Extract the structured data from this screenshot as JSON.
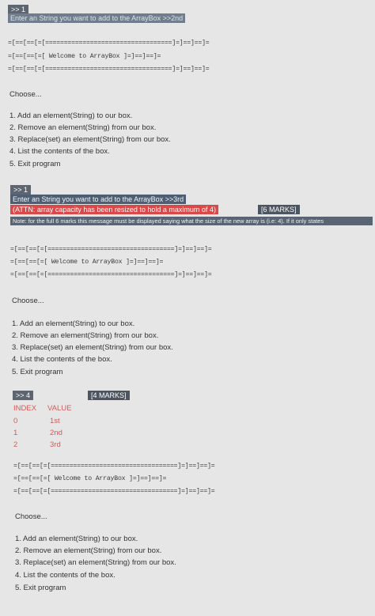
{
  "block1": {
    "tag": ">> 1",
    "prompt": "Enter an String you want to add to the ArrayBox >>2nd",
    "banner": [
      "=[==[==[=[==================================]=]==]==]=",
      "=[==[==[=[     Welcome to ArrayBox       ]=]==]==]=",
      "=[==[==[=[==================================]=]==]==]="
    ],
    "choose": "Choose...",
    "menu": [
      "1. Add an element(String) to our box.",
      "2. Remove an element(String) from our box.",
      "3. Replace(set) an element(String) from our box.",
      "4. List the contents of the box.",
      "5. Exit program"
    ]
  },
  "block2": {
    "tag": ">> 1",
    "prompt": "Enter an String you want to add to the ArrayBox >>3rd",
    "attn": "(ATTN: array capacity has been resized to hold a maximum of 4)",
    "marks": "[6 MARKS]",
    "note": "Note: for the full 6 marks this message must be displayed saying what the size of the new array is (i.e: 4). If it only states",
    "banner": [
      "=[==[==[=[==================================]=]==]==]=",
      "=[==[==[=[     Welcome to ArrayBox       ]=]==]==]=",
      "=[==[==[=[==================================]=]==]==]="
    ],
    "choose": "Choose...",
    "menu": [
      "1. Add an element(String) to our box.",
      "2. Remove an element(String) from our box.",
      "3. Replace(set) an element(String) from our box.",
      "4. List the contents of the box.",
      "5. Exit program"
    ]
  },
  "block3": {
    "tag": ">> 4",
    "marks": "[4 MARKS]",
    "headers": [
      "INDEX",
      "VALUE"
    ],
    "rows": [
      {
        "index": "0",
        "value": "1st"
      },
      {
        "index": "1",
        "value": "2nd"
      },
      {
        "index": "2",
        "value": "3rd"
      }
    ],
    "banner": [
      "=[==[==[=[==================================]=]==]==]=",
      "=[==[==[=[     Welcome to ArrayBox       ]=]==]==]=",
      "=[==[==[=[==================================]=]==]==]="
    ],
    "choose": "Choose...",
    "menu": [
      "1. Add an element(String) to our box.",
      "2. Remove an element(String) from our box.",
      "3. Replace(set) an element(String) from our box.",
      "4. List the contents of the box.",
      "5. Exit program"
    ]
  },
  "colors": {
    "background": "#e6e6e6",
    "prompt": "#6f7d8c",
    "attn": "#d84a4a",
    "table_text": "#d45a5a"
  }
}
